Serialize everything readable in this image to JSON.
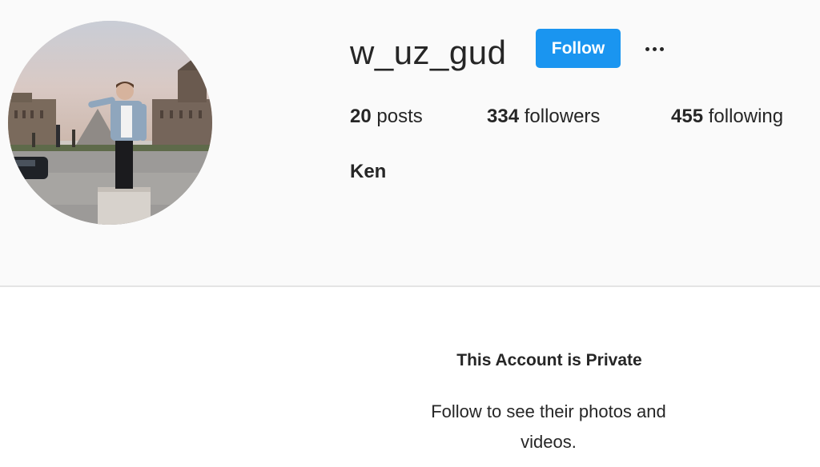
{
  "profile": {
    "username": "w_uz_gud",
    "follow_label": "Follow",
    "more_icon": "more-horizontal-icon",
    "full_name": "Ken",
    "avatar_description_icon": "profile-photo",
    "stats": {
      "posts_count": "20",
      "posts_label": "posts",
      "followers_count": "334",
      "followers_label": "followers",
      "following_count": "455",
      "following_label": "following"
    }
  },
  "private_notice": {
    "title": "This Account is Private",
    "subtitle": "Follow to see their photos and videos."
  },
  "colors": {
    "follow_button": "#1a95f0",
    "header_background": "#fafafa",
    "body_background": "#ffffff",
    "text": "#262626"
  }
}
